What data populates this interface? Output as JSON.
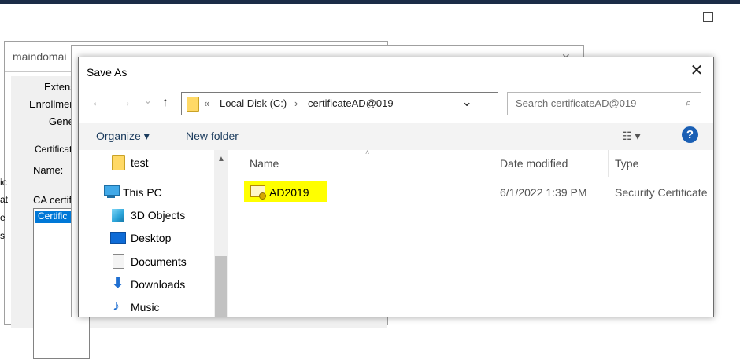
{
  "background": {
    "window_title": "maindomai",
    "tabs": [
      "Extens",
      "Enrollmen",
      "Gene"
    ],
    "group_label": "Certificat",
    "name_label": "Name:",
    "ca_label": "CA certif",
    "list_selected": "Certific",
    "edge_glyphs": [
      "ic",
      "at",
      "e",
      "s"
    ]
  },
  "dialog": {
    "title": "Save As",
    "close_glyph": "✕",
    "nav": {
      "back": "←",
      "forward": "→",
      "recent": "⌄",
      "up": "↑"
    },
    "address": {
      "chevron_left": "«",
      "segment1": "Local Disk (C:)",
      "separator": "›",
      "segment2": "certificateAD@019",
      "dropdown": "⌄",
      "refresh": "↻"
    },
    "search": {
      "placeholder": "Search certificateAD@019",
      "icon": "⌕"
    },
    "toolbar": {
      "organize": "Organize ▾",
      "new_folder": "New folder",
      "view": "☷ ▾",
      "help": "?"
    },
    "nav_pane": {
      "items": [
        {
          "label": "test",
          "icon": "folder-icon"
        },
        {
          "label": "This PC",
          "icon": "computer-icon"
        },
        {
          "label": "3D Objects",
          "icon": "cube-icon"
        },
        {
          "label": "Desktop",
          "icon": "desktop-icon"
        },
        {
          "label": "Documents",
          "icon": "document-icon"
        },
        {
          "label": "Downloads",
          "icon": "download-icon"
        },
        {
          "label": "Music",
          "icon": "music-icon"
        }
      ],
      "scroll_up": "▲"
    },
    "file_list": {
      "columns": [
        "Name",
        "Date modified",
        "Type"
      ],
      "sort_indicator": "˄",
      "rows": [
        {
          "name": "AD2019",
          "date_modified": "6/1/2022 1:39 PM",
          "type": "Security Certificate",
          "highlight_color": "#ffff00"
        }
      ]
    }
  },
  "colors": {
    "accent": "#0078d7",
    "help": "#1a5fb4",
    "titlebar_strip": "#1b2c47"
  }
}
